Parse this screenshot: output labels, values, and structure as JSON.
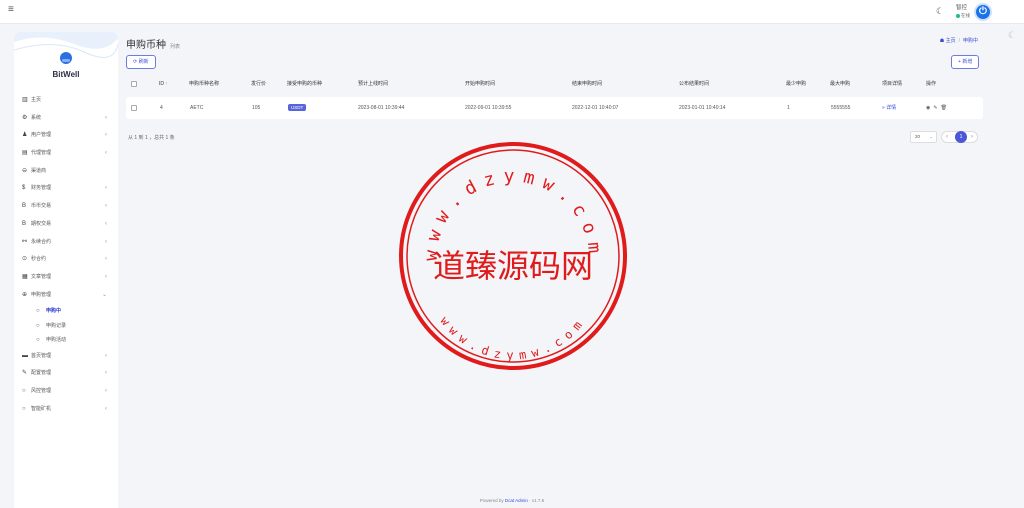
{
  "header": {
    "menu_icon": "hamburger-icon",
    "theme_icon": "moon-icon",
    "user_name": "智控",
    "user_status": "在线",
    "power_icon": "power-icon"
  },
  "sidebar": {
    "brand": "BitWell",
    "items": [
      {
        "icon": "▥",
        "label": "主页",
        "chevron": ""
      },
      {
        "icon": "⚙",
        "label": "系统",
        "chevron": "‹"
      },
      {
        "icon": "♟",
        "label": "用户管理",
        "chevron": "‹"
      },
      {
        "icon": "▤",
        "label": "代理管理",
        "chevron": "‹"
      },
      {
        "icon": "⊖",
        "label": "渠道商",
        "chevron": ""
      },
      {
        "icon": "$",
        "label": "财务管理",
        "chevron": "‹"
      },
      {
        "icon": "B",
        "label": "币币交易",
        "chevron": "‹"
      },
      {
        "icon": "B",
        "label": "期权交易",
        "chevron": "‹"
      },
      {
        "icon": "⚯",
        "label": "永续合约",
        "chevron": "‹"
      },
      {
        "icon": "⊙",
        "label": "秒合约",
        "chevron": "‹"
      },
      {
        "icon": "▦",
        "label": "文章管理",
        "chevron": "‹"
      },
      {
        "icon": "⊕",
        "label": "申购管理",
        "chevron": "⌄"
      }
    ],
    "subitems": [
      {
        "icon": "○",
        "label": "申购中",
        "active": true
      },
      {
        "icon": "○",
        "label": "申购记录",
        "active": false
      },
      {
        "icon": "○",
        "label": "申购活动",
        "active": false
      }
    ],
    "items_after": [
      {
        "icon": "▬",
        "label": "首页管理",
        "chevron": "‹"
      },
      {
        "icon": "✎",
        "label": "配置管理",
        "chevron": "‹"
      },
      {
        "icon": "○",
        "label": "风控管理",
        "chevron": "‹"
      },
      {
        "icon": "○",
        "label": "智能矿机",
        "chevron": "‹"
      }
    ]
  },
  "page": {
    "title": "申购币种",
    "subtitle": "列表",
    "breadcrumb_home": "主页",
    "breadcrumb_current": "申购中",
    "refresh_label": "刷新",
    "add_label": "新增"
  },
  "table": {
    "headers": [
      "ID",
      "申购币种名称",
      "发行价",
      "接受申购的币种",
      "预计上线时间",
      "开始申购时间",
      "结束申购时间",
      "公布结果时间",
      "最少申购",
      "最大申购",
      "项目详情",
      "操作"
    ],
    "sort_icon": "↑",
    "rows": [
      {
        "id": "4",
        "name": "AETC",
        "price": "105",
        "currency": "USDT",
        "listing_time": "2023-08-01 10:39:44",
        "start_time": "2022-09-01 10:39:55",
        "end_time": "2022-12-01 10:40:07",
        "result_time": "2023-01-01 10:40:14",
        "min": "1",
        "max": "5555555",
        "detail": "详情"
      }
    ]
  },
  "pagination": {
    "info": "从 1 到 1 ，总共 1 条",
    "page_size": "20",
    "current_page": "1"
  },
  "footer": {
    "prefix": "Powered by",
    "link": "Dcat Admin",
    "version": "· v1.7.8"
  },
  "watermark": {
    "center_text": "道臻源码网",
    "top_text": "www.dzymw.com",
    "bottom_text": "www.dzymw.com",
    "color": "#e01b1b"
  }
}
